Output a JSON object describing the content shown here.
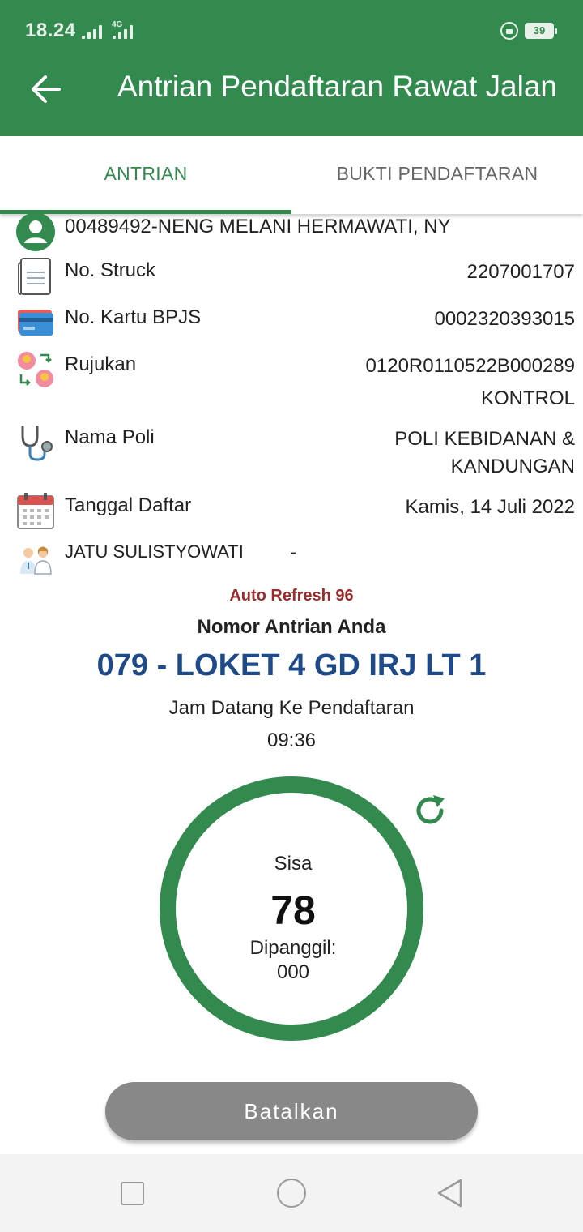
{
  "status_bar": {
    "time": "18.24",
    "network": "4G",
    "battery": "39"
  },
  "header": {
    "title": "Antrian Pendaftaran Rawat Jalan",
    "back_icon": "arrow-left-icon"
  },
  "tabs": [
    {
      "label": "ANTRIAN",
      "active": true
    },
    {
      "label": "BUKTI PENDAFTARAN",
      "active": false
    }
  ],
  "patient": {
    "name": "00489492-NENG MELANI HERMAWATI, NY"
  },
  "details": {
    "struck_label": "No. Struck",
    "struck_value": "2207001707",
    "bpjs_label": "No. Kartu BPJS",
    "bpjs_value": "0002320393015",
    "rujukan_label": "Rujukan",
    "rujukan_value_line1": "0120R0110522B000289",
    "rujukan_value_line2": "KONTROL",
    "poli_label": "Nama Poli",
    "poli_value_line1": "POLI KEBIDANAN &",
    "poli_value_line2": "KANDUNGAN",
    "tanggal_label": "Tanggal Daftar",
    "tanggal_value": "Kamis, 14 Juli 2022",
    "dokter_label": "JATU SULISTYOWATI",
    "dokter_value": "-"
  },
  "queue": {
    "auto_refresh": "Auto Refresh 96",
    "nomor_label": "Nomor Antrian Anda",
    "nomor_value": "079 - LOKET 4 GD IRJ LT 1",
    "jam_label": "Jam Datang Ke Pendaftaran",
    "jam_value": "09:36",
    "sisa_label": "Sisa",
    "sisa_value": "78",
    "dipanggil_label": "Dipanggil:",
    "dipanggil_value": "000"
  },
  "actions": {
    "cancel_label": "Batalkan"
  },
  "colors": {
    "primary": "#328a4e",
    "queue_number": "#1f4a8a",
    "auto_refresh": "#9b2b2b",
    "button_disabled": "#888888"
  }
}
